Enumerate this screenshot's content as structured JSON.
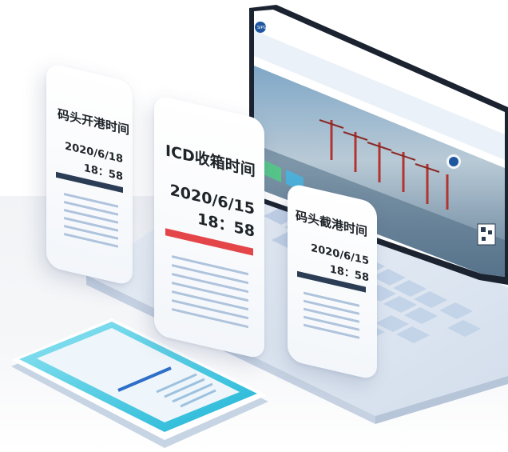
{
  "cards": {
    "left": {
      "title": "码头开港时间",
      "date": "2020/6/18",
      "time": "18：58",
      "bar_color": "#2b3d55"
    },
    "middle": {
      "title": "ICD收箱时间",
      "date": "2020/6/15",
      "time": "18：58",
      "bar_color": "#e44548"
    },
    "right": {
      "title": "码头截港时间",
      "date": "2020/6/15",
      "time": "18：58",
      "bar_color": "#2b3d55"
    }
  },
  "colors": {
    "accent_red": "#e44548",
    "navy": "#2b3d55",
    "phone_cyan": "#27c0dc",
    "laptop_body": "#dde6f1"
  }
}
